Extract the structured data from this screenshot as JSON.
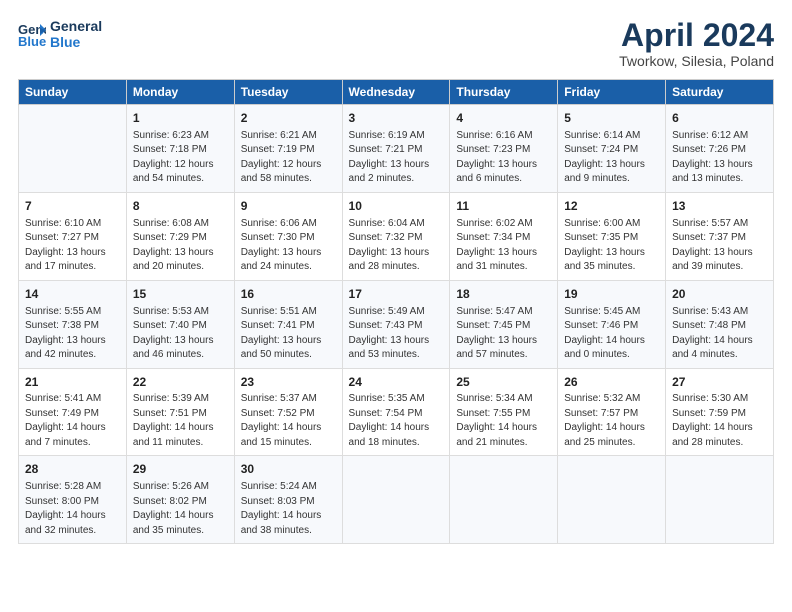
{
  "header": {
    "logo_line1": "General",
    "logo_line2": "Blue",
    "title": "April 2024",
    "subtitle": "Tworkow, Silesia, Poland"
  },
  "days_of_week": [
    "Sunday",
    "Monday",
    "Tuesday",
    "Wednesday",
    "Thursday",
    "Friday",
    "Saturday"
  ],
  "weeks": [
    [
      {
        "day": "",
        "content": ""
      },
      {
        "day": "1",
        "content": "Sunrise: 6:23 AM\nSunset: 7:18 PM\nDaylight: 12 hours\nand 54 minutes."
      },
      {
        "day": "2",
        "content": "Sunrise: 6:21 AM\nSunset: 7:19 PM\nDaylight: 12 hours\nand 58 minutes."
      },
      {
        "day": "3",
        "content": "Sunrise: 6:19 AM\nSunset: 7:21 PM\nDaylight: 13 hours\nand 2 minutes."
      },
      {
        "day": "4",
        "content": "Sunrise: 6:16 AM\nSunset: 7:23 PM\nDaylight: 13 hours\nand 6 minutes."
      },
      {
        "day": "5",
        "content": "Sunrise: 6:14 AM\nSunset: 7:24 PM\nDaylight: 13 hours\nand 9 minutes."
      },
      {
        "day": "6",
        "content": "Sunrise: 6:12 AM\nSunset: 7:26 PM\nDaylight: 13 hours\nand 13 minutes."
      }
    ],
    [
      {
        "day": "7",
        "content": "Sunrise: 6:10 AM\nSunset: 7:27 PM\nDaylight: 13 hours\nand 17 minutes."
      },
      {
        "day": "8",
        "content": "Sunrise: 6:08 AM\nSunset: 7:29 PM\nDaylight: 13 hours\nand 20 minutes."
      },
      {
        "day": "9",
        "content": "Sunrise: 6:06 AM\nSunset: 7:30 PM\nDaylight: 13 hours\nand 24 minutes."
      },
      {
        "day": "10",
        "content": "Sunrise: 6:04 AM\nSunset: 7:32 PM\nDaylight: 13 hours\nand 28 minutes."
      },
      {
        "day": "11",
        "content": "Sunrise: 6:02 AM\nSunset: 7:34 PM\nDaylight: 13 hours\nand 31 minutes."
      },
      {
        "day": "12",
        "content": "Sunrise: 6:00 AM\nSunset: 7:35 PM\nDaylight: 13 hours\nand 35 minutes."
      },
      {
        "day": "13",
        "content": "Sunrise: 5:57 AM\nSunset: 7:37 PM\nDaylight: 13 hours\nand 39 minutes."
      }
    ],
    [
      {
        "day": "14",
        "content": "Sunrise: 5:55 AM\nSunset: 7:38 PM\nDaylight: 13 hours\nand 42 minutes."
      },
      {
        "day": "15",
        "content": "Sunrise: 5:53 AM\nSunset: 7:40 PM\nDaylight: 13 hours\nand 46 minutes."
      },
      {
        "day": "16",
        "content": "Sunrise: 5:51 AM\nSunset: 7:41 PM\nDaylight: 13 hours\nand 50 minutes."
      },
      {
        "day": "17",
        "content": "Sunrise: 5:49 AM\nSunset: 7:43 PM\nDaylight: 13 hours\nand 53 minutes."
      },
      {
        "day": "18",
        "content": "Sunrise: 5:47 AM\nSunset: 7:45 PM\nDaylight: 13 hours\nand 57 minutes."
      },
      {
        "day": "19",
        "content": "Sunrise: 5:45 AM\nSunset: 7:46 PM\nDaylight: 14 hours\nand 0 minutes."
      },
      {
        "day": "20",
        "content": "Sunrise: 5:43 AM\nSunset: 7:48 PM\nDaylight: 14 hours\nand 4 minutes."
      }
    ],
    [
      {
        "day": "21",
        "content": "Sunrise: 5:41 AM\nSunset: 7:49 PM\nDaylight: 14 hours\nand 7 minutes."
      },
      {
        "day": "22",
        "content": "Sunrise: 5:39 AM\nSunset: 7:51 PM\nDaylight: 14 hours\nand 11 minutes."
      },
      {
        "day": "23",
        "content": "Sunrise: 5:37 AM\nSunset: 7:52 PM\nDaylight: 14 hours\nand 15 minutes."
      },
      {
        "day": "24",
        "content": "Sunrise: 5:35 AM\nSunset: 7:54 PM\nDaylight: 14 hours\nand 18 minutes."
      },
      {
        "day": "25",
        "content": "Sunrise: 5:34 AM\nSunset: 7:55 PM\nDaylight: 14 hours\nand 21 minutes."
      },
      {
        "day": "26",
        "content": "Sunrise: 5:32 AM\nSunset: 7:57 PM\nDaylight: 14 hours\nand 25 minutes."
      },
      {
        "day": "27",
        "content": "Sunrise: 5:30 AM\nSunset: 7:59 PM\nDaylight: 14 hours\nand 28 minutes."
      }
    ],
    [
      {
        "day": "28",
        "content": "Sunrise: 5:28 AM\nSunset: 8:00 PM\nDaylight: 14 hours\nand 32 minutes."
      },
      {
        "day": "29",
        "content": "Sunrise: 5:26 AM\nSunset: 8:02 PM\nDaylight: 14 hours\nand 35 minutes."
      },
      {
        "day": "30",
        "content": "Sunrise: 5:24 AM\nSunset: 8:03 PM\nDaylight: 14 hours\nand 38 minutes."
      },
      {
        "day": "",
        "content": ""
      },
      {
        "day": "",
        "content": ""
      },
      {
        "day": "",
        "content": ""
      },
      {
        "day": "",
        "content": ""
      }
    ]
  ]
}
